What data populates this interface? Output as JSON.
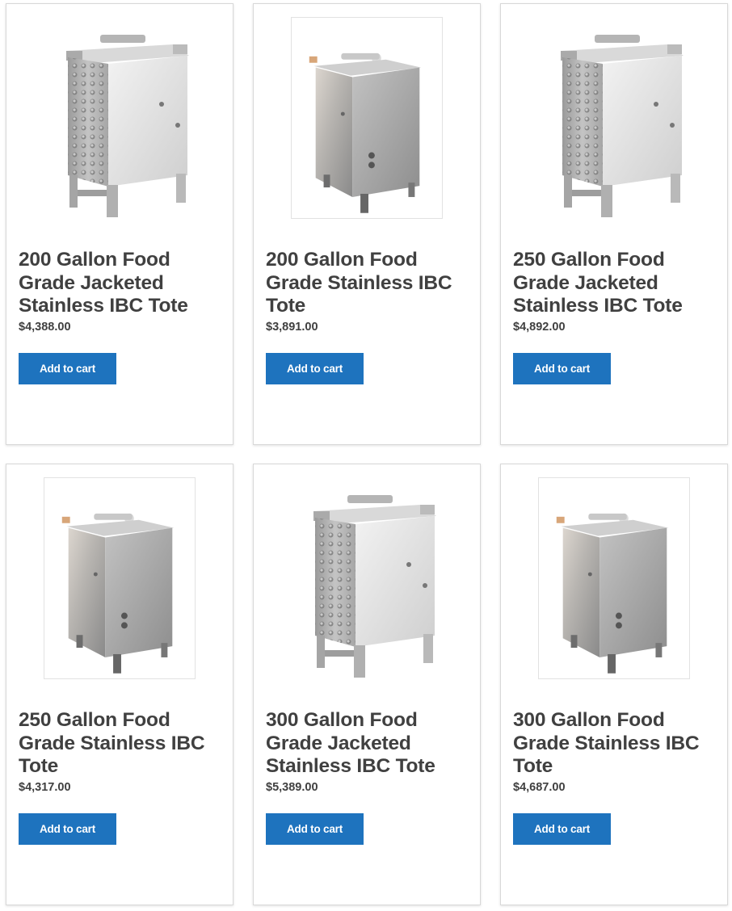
{
  "colors": {
    "button_bg": "#1e73be",
    "button_text": "#ffffff",
    "title_text": "#404040",
    "card_border": "#d8d8d8"
  },
  "products": [
    {
      "title": "200 Gallon Food Grade Jacketed Stainless IBC Tote",
      "price": "$4,388.00",
      "button_label": "Add to cart",
      "image_icon": "jacketed-tote-image"
    },
    {
      "title": "200 Gallon Food Grade Stainless IBC Tote",
      "price": "$3,891.00",
      "button_label": "Add to cart",
      "image_icon": "stainless-tote-image"
    },
    {
      "title": "250 Gallon Food Grade Jacketed Stainless IBC Tote",
      "price": "$4,892.00",
      "button_label": "Add to cart",
      "image_icon": "jacketed-tote-image"
    },
    {
      "title": "250 Gallon Food Grade Stainless IBC Tote",
      "price": "$4,317.00",
      "button_label": "Add to cart",
      "image_icon": "stainless-tote-image"
    },
    {
      "title": "300 Gallon Food Grade Jacketed Stainless IBC Tote",
      "price": "$5,389.00",
      "button_label": "Add to cart",
      "image_icon": "jacketed-tote-image"
    },
    {
      "title": "300 Gallon Food Grade Stainless IBC Tote",
      "price": "$4,687.00",
      "button_label": "Add to cart",
      "image_icon": "stainless-tote-image"
    }
  ]
}
